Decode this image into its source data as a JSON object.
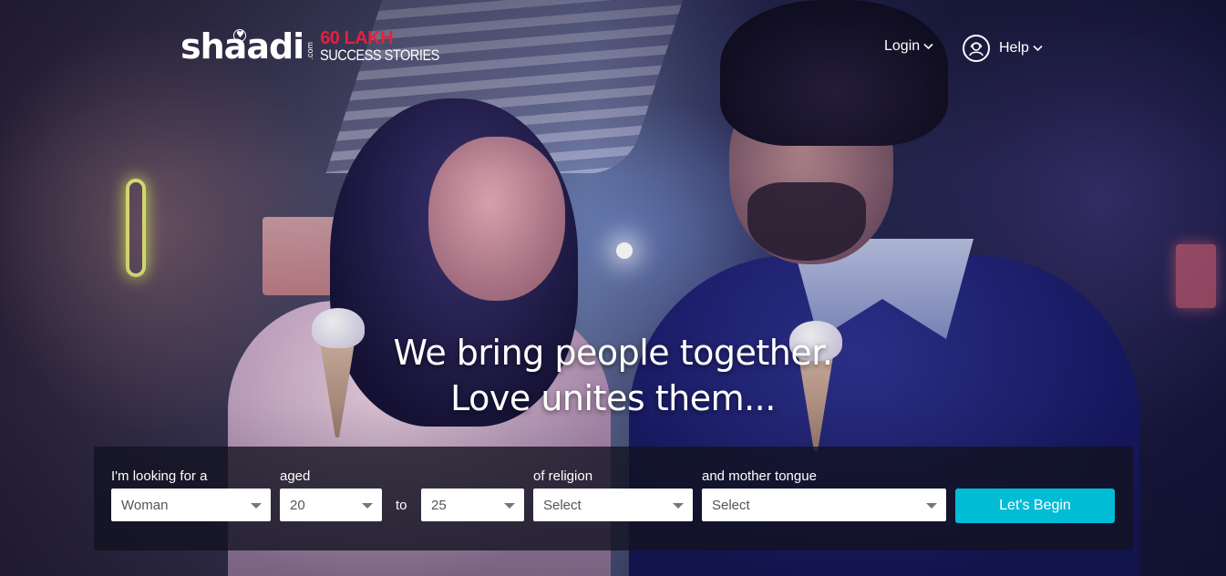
{
  "header": {
    "logo": {
      "wordmark": "shaadi",
      "domain_suffix": ".com",
      "tagline_count": "60 LAKH",
      "tagline_label": "SUCCESS STORIES"
    },
    "nav": {
      "login_label": "Login",
      "help_label": "Help"
    }
  },
  "hero": {
    "line1": "We bring people together.",
    "line2": "Love unites them..."
  },
  "search": {
    "looking_for_label": "I'm looking for a",
    "looking_for_value": "Woman",
    "aged_label": "aged",
    "age_from_value": "20",
    "to_label": "to",
    "age_to_value": "25",
    "religion_label": "of religion",
    "religion_value": "Select",
    "tongue_label": "and mother tongue",
    "tongue_value": "Select",
    "submit_label": "Let's Begin"
  },
  "colors": {
    "accent": "#00bcd5",
    "logo_red": "#e2223a",
    "panel_bg": "rgba(18,18,32,0.78)"
  }
}
